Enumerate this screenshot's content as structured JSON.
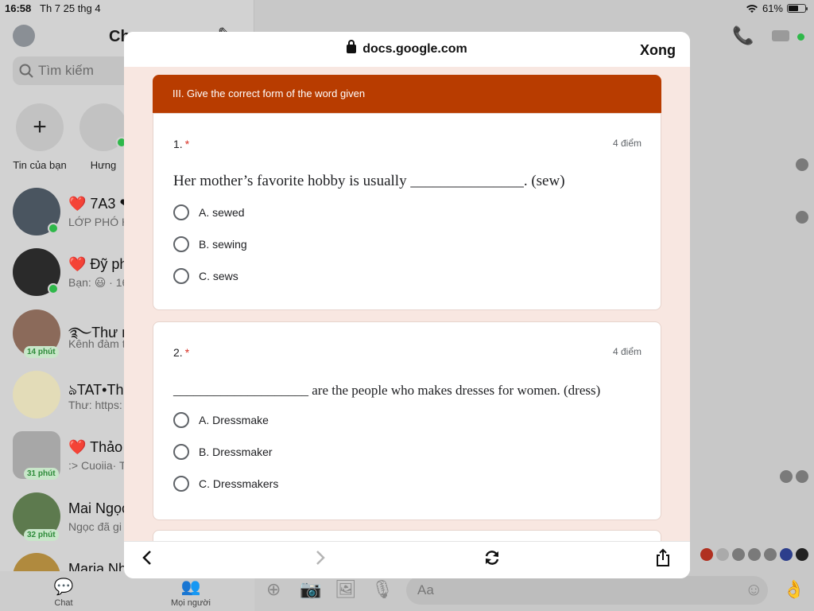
{
  "status_bar": {
    "time": "16:58",
    "date": "Th 7 25 thg 4",
    "battery": "61%",
    "battery_level": 0.61
  },
  "sidebar": {
    "title": "Ch",
    "search_placeholder": "Tìm kiếm",
    "stories": [
      {
        "label": "Tin của bạn",
        "glyph": "+"
      },
      {
        "label": "Hưng"
      }
    ],
    "chats": [
      {
        "name": "❤️ 7A3 ❤",
        "preview": "LỚP PHÓ H",
        "badge": ""
      },
      {
        "name": "❤️ Đỹ ph",
        "preview": "Bạn: 😃 · 16",
        "badge": ""
      },
      {
        "name": "࿐Thư m",
        "preview": "Kênh đàm t",
        "badge": "14 phút"
      },
      {
        "name": "ঌTAT•Thư",
        "preview": "Thư: https:",
        "badge": ""
      },
      {
        "name": "❤️ Thảo",
        "preview": ":> Cuoiia· T",
        "badge": "31 phút"
      },
      {
        "name": "Mai Ngọc",
        "preview": "Ngọc đã gi",
        "badge": "32 phút"
      },
      {
        "name": "Maria Nh",
        "preview": "",
        "badge": ""
      }
    ],
    "tabs": [
      {
        "label": "Chat"
      },
      {
        "label": "Mọi người"
      }
    ]
  },
  "conversation": {
    "input_placeholder": "Aa"
  },
  "browser": {
    "url": "docs.google.com",
    "done_label": "Xong"
  },
  "form": {
    "section_title": "III. Give the correct form of the word given",
    "questions": [
      {
        "number": "1.",
        "required_mark": "*",
        "points": "4 điểm",
        "text": "Her mother’s favorite hobby is usually _______________. (sew)",
        "options": [
          "A. sewed",
          "B. sewing",
          "C. sews"
        ]
      },
      {
        "number": "2.",
        "required_mark": "*",
        "points": "4 điểm",
        "text": "____________________ are the people who makes dresses for women. (dress)",
        "options": [
          "A. Dressmake",
          "B. Dressmaker",
          "C. Dressmakers"
        ]
      }
    ],
    "feedback_glyph": "!"
  },
  "icons": {
    "back": "chevron-left-icon",
    "forward": "chevron-right-icon",
    "reload": "reload-icon",
    "share": "share-icon"
  }
}
